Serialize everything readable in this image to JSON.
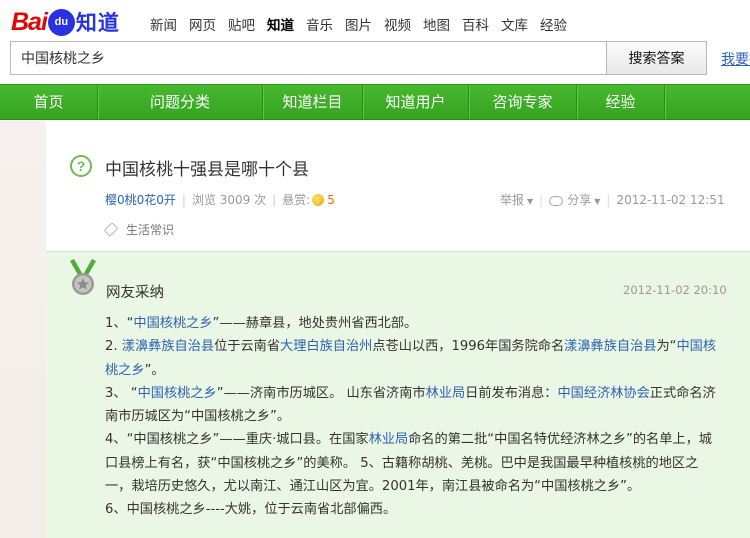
{
  "logo": {
    "bai": "Bai",
    "du": "du",
    "suffix": "知道"
  },
  "topnav": [
    "新闻",
    "网页",
    "贴吧",
    "知道",
    "音乐",
    "图片",
    "视频",
    "地图",
    "百科",
    "文库",
    "经验"
  ],
  "search": {
    "value": "中国核桃之乡",
    "button": "搜索答案",
    "ask": "我要提问"
  },
  "greennav": [
    "首页",
    "问题分类",
    "知道栏目",
    "知道用户",
    "咨询专家",
    "经验"
  ],
  "question": {
    "title": "中国核桃十强县是哪十个县",
    "user": "樱0桃0花0开",
    "views": "浏览 3009 次",
    "reward_label": "悬赏:",
    "reward_value": "5",
    "report": "举报",
    "share": "分享",
    "time": "2012-11-02 12:51",
    "tag": "生活常识"
  },
  "answer": {
    "title": "网友采纳",
    "time": "2012-11-02 20:10",
    "p1": {
      "a": "1、“",
      "b": "中国核桃之乡",
      "c": "”——赫章县，地处贵州省西北部。"
    },
    "p2": {
      "a": "漾濞彝族自治县",
      "b": "位于云南省",
      "c": "大理白族自治州",
      "d": "点苍山以西，1996年国务院命名",
      "e": "漾濞彝族自治县",
      "f": "为“",
      "g": "中国核桃之乡",
      "h": "”。",
      "num": "2. "
    },
    "p3": {
      "a": "3、 “",
      "b": "中国核桃之乡",
      "c": "”——济南市历城区。 山东省济南市",
      "d": "林业局",
      "e": "日前发布消息：",
      "f": "中国经济林协会",
      "g": "正式命名济南市历城区为“中国核桃之乡”。"
    },
    "p4": {
      "a": "4、“中国核桃之乡”——重庆·城口县。在国家",
      "b": "林业局",
      "c": "命名的第二批“中国名特优经济林之乡”的名单上，城口县榜上有名，获“中国核桃之乡”的美称。 5、古籍称胡桃、羌桃。巴中是我国最早种植核桃的地区之一，栽培历史悠久，尤以南江、通江山区为宜。2001年，南江县被命名为“中国核桃之乡”。"
    },
    "p5": "6、中国核桃之乡----大姚，位于云南省北部偏西。"
  },
  "colors": {
    "green": "#3aa824",
    "link": "#2d64b3",
    "answer_bg": "#eaf7e4",
    "logo_red": "#e10601",
    "logo_blue": "#2932e1"
  }
}
